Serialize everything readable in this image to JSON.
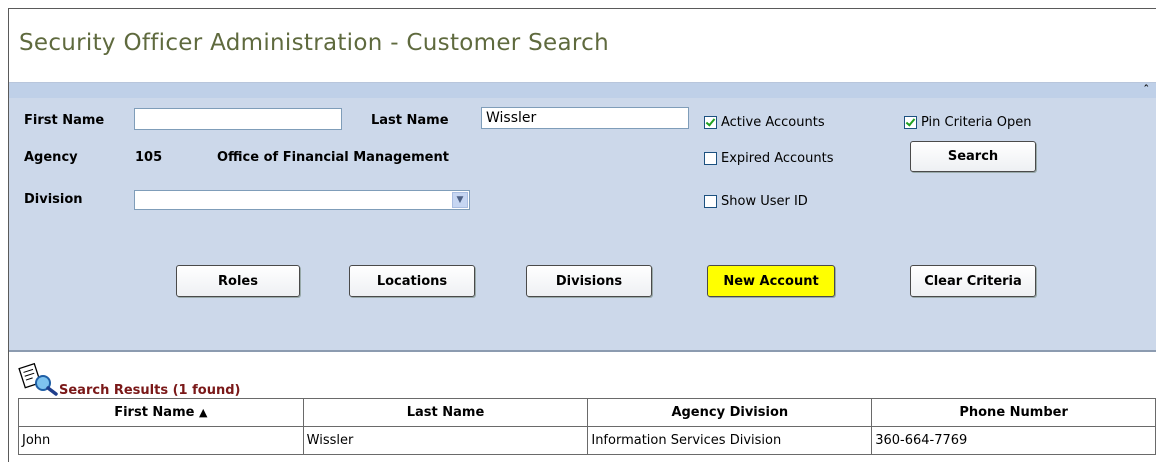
{
  "page": {
    "title": "Security Officer Administration - Customer Search",
    "collapse_glyph": "ˆ"
  },
  "criteria": {
    "first_name_label": "First Name",
    "first_name_value": "",
    "last_name_label": "Last Name",
    "last_name_value": "Wissler",
    "agency_label": "Agency",
    "agency_code": "105",
    "agency_name": "Office of Financial Management",
    "division_label": "Division",
    "division_value": "",
    "active_accounts_label": "Active Accounts",
    "active_accounts_checked": true,
    "expired_accounts_label": "Expired Accounts",
    "expired_accounts_checked": false,
    "show_user_id_label": "Show User ID",
    "show_user_id_checked": false,
    "pin_criteria_label": "Pin Criteria Open",
    "pin_criteria_checked": true,
    "search_button": "Search"
  },
  "actions": {
    "roles": "Roles",
    "locations": "Locations",
    "divisions": "Divisions",
    "new_account": "New Account",
    "clear_criteria": "Clear Criteria"
  },
  "results": {
    "title": "Search Results (1 found)",
    "columns": [
      "First Name",
      "Last Name",
      "Agency Division",
      "Phone Number"
    ],
    "sort_indicator": "▲",
    "rows": [
      [
        "John",
        "Wissler",
        "Information Services Division",
        "360-664-7769"
      ]
    ]
  },
  "colors": {
    "panel_bg": "#ccd8ea",
    "new_account_bg": "#ffff00",
    "results_title": "#7a1818",
    "page_title": "#5f6a3e"
  }
}
